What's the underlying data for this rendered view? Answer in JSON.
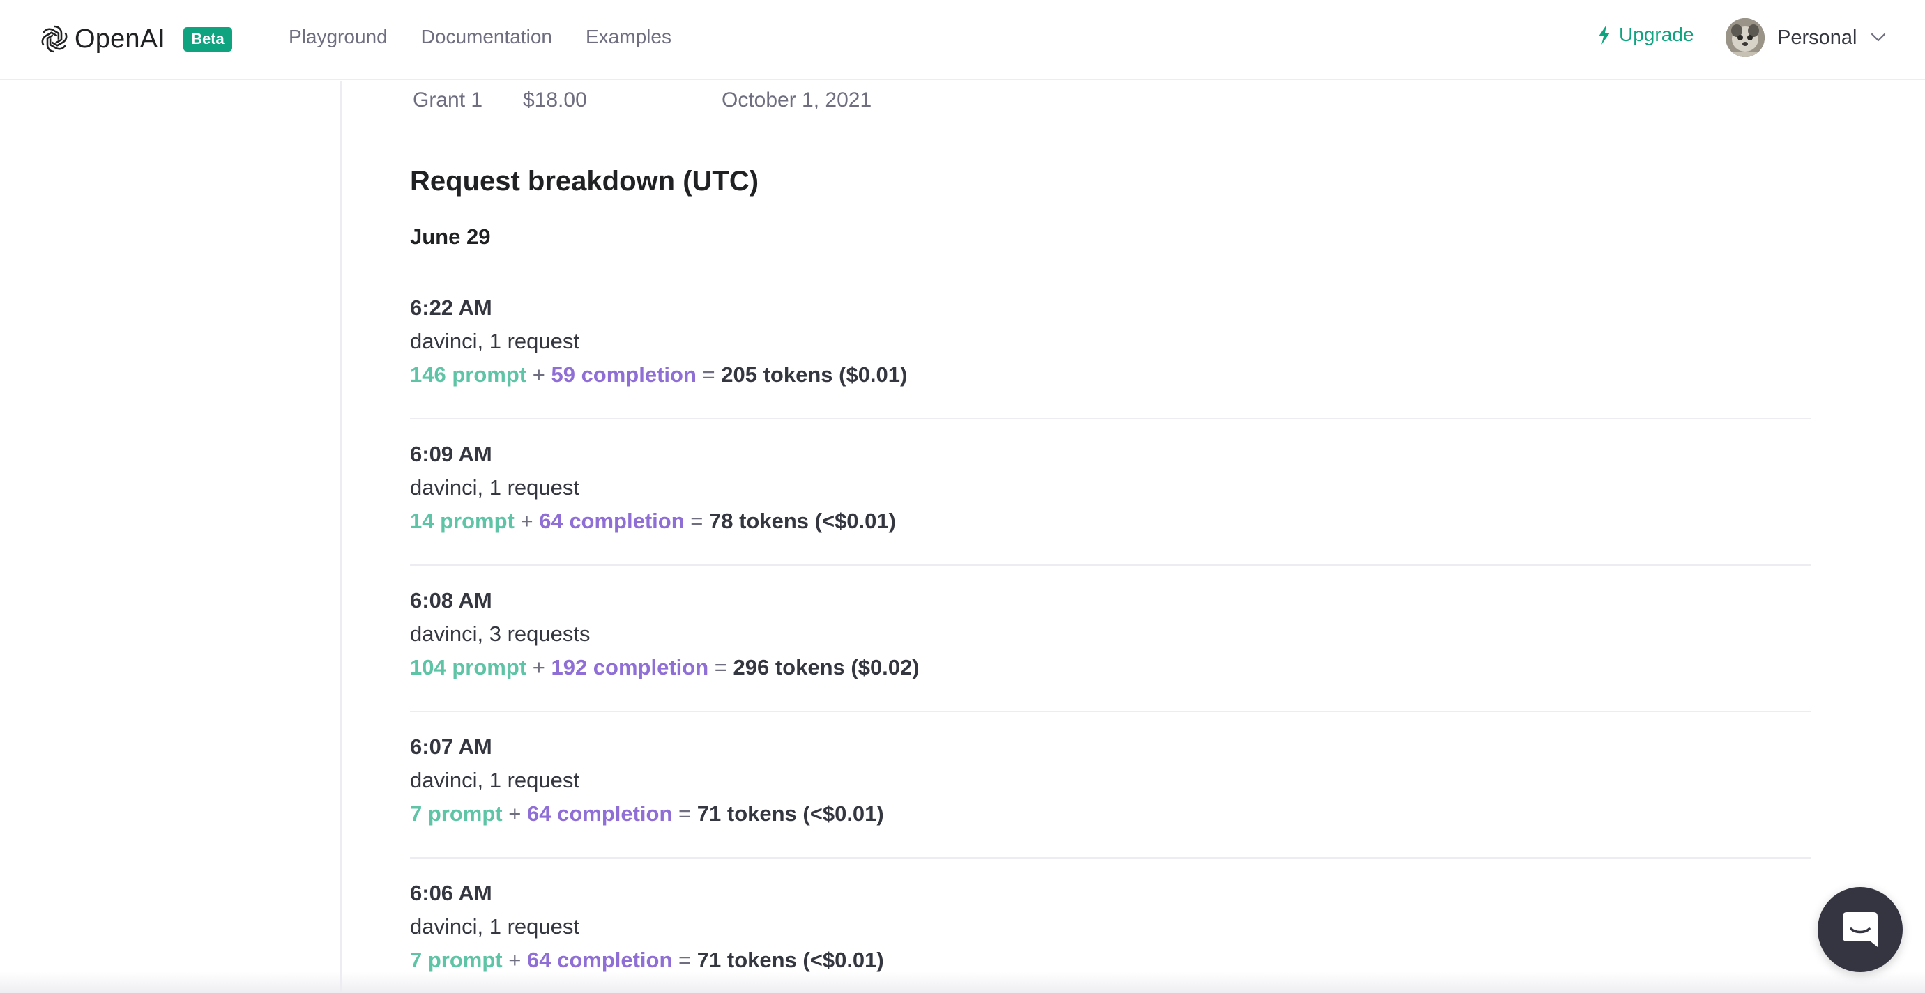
{
  "header": {
    "brand": "OpenAI",
    "badge": "Beta",
    "nav": [
      {
        "label": "Playground"
      },
      {
        "label": "Documentation"
      },
      {
        "label": "Examples"
      }
    ],
    "upgrade_label": "Upgrade",
    "account_label": "Personal",
    "icons": {
      "logo": "openai-logo-icon",
      "upgrade": "lightning-bolt-icon",
      "account_menu": "chevron-down-icon",
      "chat": "chat-bubble-icon"
    },
    "colors": {
      "accent": "#10a37f",
      "prompt": "#5fc4a5",
      "completion": "#8f6fd6"
    }
  },
  "grant": {
    "name": "Grant 1",
    "amount": "$18.00",
    "expires": "October 1, 2021"
  },
  "breakdown": {
    "title": "Request breakdown (UTC)",
    "date": "June 29",
    "plus": "+",
    "equals": "=",
    "entries": [
      {
        "time": "6:22 AM",
        "model": "davinci, 1 request",
        "prompt": "146 prompt",
        "completion": "59 completion",
        "total": "205 tokens ($0.01)"
      },
      {
        "time": "6:09 AM",
        "model": "davinci, 1 request",
        "prompt": "14 prompt",
        "completion": "64 completion",
        "total": "78 tokens (<$0.01)"
      },
      {
        "time": "6:08 AM",
        "model": "davinci, 3 requests",
        "prompt": "104 prompt",
        "completion": "192 completion",
        "total": "296 tokens ($0.02)"
      },
      {
        "time": "6:07 AM",
        "model": "davinci, 1 request",
        "prompt": "7 prompt",
        "completion": "64 completion",
        "total": "71 tokens (<$0.01)"
      },
      {
        "time": "6:06 AM",
        "model": "davinci, 1 request",
        "prompt": "7 prompt",
        "completion": "64 completion",
        "total": "71 tokens (<$0.01)"
      }
    ]
  }
}
